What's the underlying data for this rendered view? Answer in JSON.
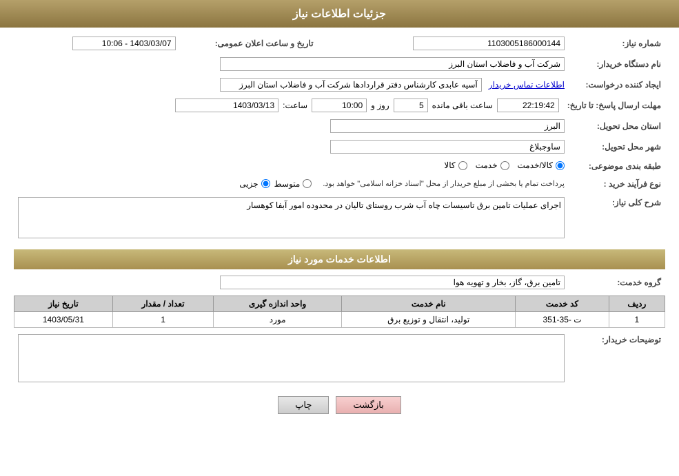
{
  "header": {
    "title": "جزئیات اطلاعات نیاز"
  },
  "form": {
    "need_number_label": "شماره نیاز:",
    "need_number_value": "1103005186000144",
    "public_announce_label": "تاریخ و ساعت اعلان عمومی:",
    "public_announce_value": "1403/03/07 - 10:06",
    "buyer_station_label": "نام دستگاه خریدار:",
    "buyer_station_value": "شرکت آب و فاضلاب استان البرز",
    "creator_label": "ایجاد کننده درخواست:",
    "creator_value": "آسیه عابدی کارشناس دفتر قراردادها شرکت آب و فاضلاب استان البرز",
    "contact_link": "اطلاعات تماس خریدار",
    "deadline_label": "مهلت ارسال پاسخ: تا تاریخ:",
    "deadline_date": "1403/03/13",
    "deadline_time_label": "ساعت:",
    "deadline_time": "10:00",
    "deadline_day_label": "روز و",
    "deadline_days": "5",
    "deadline_countdown_label": "ساعت باقی مانده",
    "deadline_countdown": "22:19:42",
    "province_label": "استان محل تحویل:",
    "province_value": "البرز",
    "city_label": "شهر محل تحویل:",
    "city_value": "ساوجبلاغ",
    "category_label": "طبقه بندی موضوعی:",
    "category_kala": "کالا",
    "category_khadamat": "خدمت",
    "category_kala_khadamat": "کالا/خدمت",
    "process_type_label": "نوع فرآیند خرید :",
    "process_jozi": "جزیی",
    "process_motavaset": "متوسط",
    "process_note": "پرداخت تمام یا بخشی از مبلغ خریدار از محل \"اسناد خزانه اسلامی\" خواهد بود.",
    "need_description_section": "اطلاعات خدمات مورد نیاز",
    "need_desc_label": "شرح کلی نیاز:",
    "need_desc_value": "اجرای عملیات تامین برق تاسیسات چاه آب شرب روستای تالیان در محدوده امور آبفا کوهسار",
    "service_group_label": "گروه خدمت:",
    "service_group_value": "تامین برق، گاز، بخار و تهویه هوا",
    "table_headers": {
      "row_num": "ردیف",
      "service_code": "کد خدمت",
      "service_name": "نام خدمت",
      "unit": "واحد اندازه گیری",
      "quantity": "تعداد / مقدار",
      "date": "تاریخ نیاز"
    },
    "table_rows": [
      {
        "row_num": "1",
        "service_code": "ت -35-351",
        "service_name": "تولید، انتقال و توزیع برق",
        "unit": "مورد",
        "quantity": "1",
        "date": "1403/05/31"
      }
    ],
    "buyer_notes_label": "توضیحات خریدار:",
    "buyer_notes_value": "",
    "btn_print": "چاپ",
    "btn_back": "بازگشت"
  }
}
